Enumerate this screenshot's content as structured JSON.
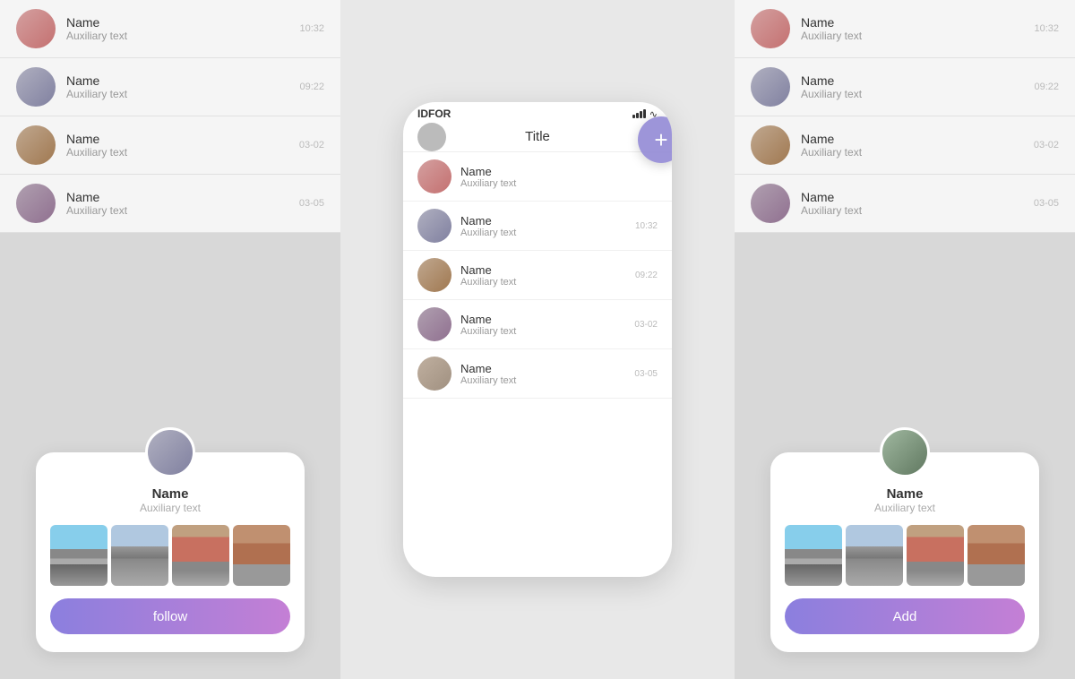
{
  "panels": {
    "contacts": [
      {
        "name": "Name",
        "aux": "Auxiliary text",
        "time": "10:32",
        "avClass": "av1"
      },
      {
        "name": "Name",
        "aux": "Auxiliary text",
        "time": "09:22",
        "avClass": "av2"
      },
      {
        "name": "Name",
        "aux": "Auxiliary text",
        "time": "03-02",
        "avClass": "av3"
      },
      {
        "name": "Name",
        "aux": "Auxiliary text",
        "time": "03-05",
        "avClass": "av4"
      }
    ]
  },
  "left_card": {
    "name": "Name",
    "aux": "Auxiliary text",
    "btn": "follow"
  },
  "right_card": {
    "name": "Name",
    "aux": "Auxiliary text",
    "btn": "Add"
  },
  "middle_phone": {
    "status_left": "IDFOR",
    "title": "Title",
    "fab_label": "+",
    "contacts": [
      {
        "name": "Name",
        "aux": "Auxiliary text",
        "time": "",
        "avClass": "av1"
      },
      {
        "name": "Name",
        "aux": "Auxiliary text",
        "time": "10:32",
        "avClass": "av2"
      },
      {
        "name": "Name",
        "aux": "Auxiliary text",
        "time": "09:22",
        "avClass": "av3"
      },
      {
        "name": "Name",
        "aux": "Auxiliary text",
        "time": "03-02",
        "avClass": "av4"
      },
      {
        "name": "Name",
        "aux": "Auxiliary text",
        "time": "03-05",
        "avClass": "av5"
      }
    ]
  }
}
